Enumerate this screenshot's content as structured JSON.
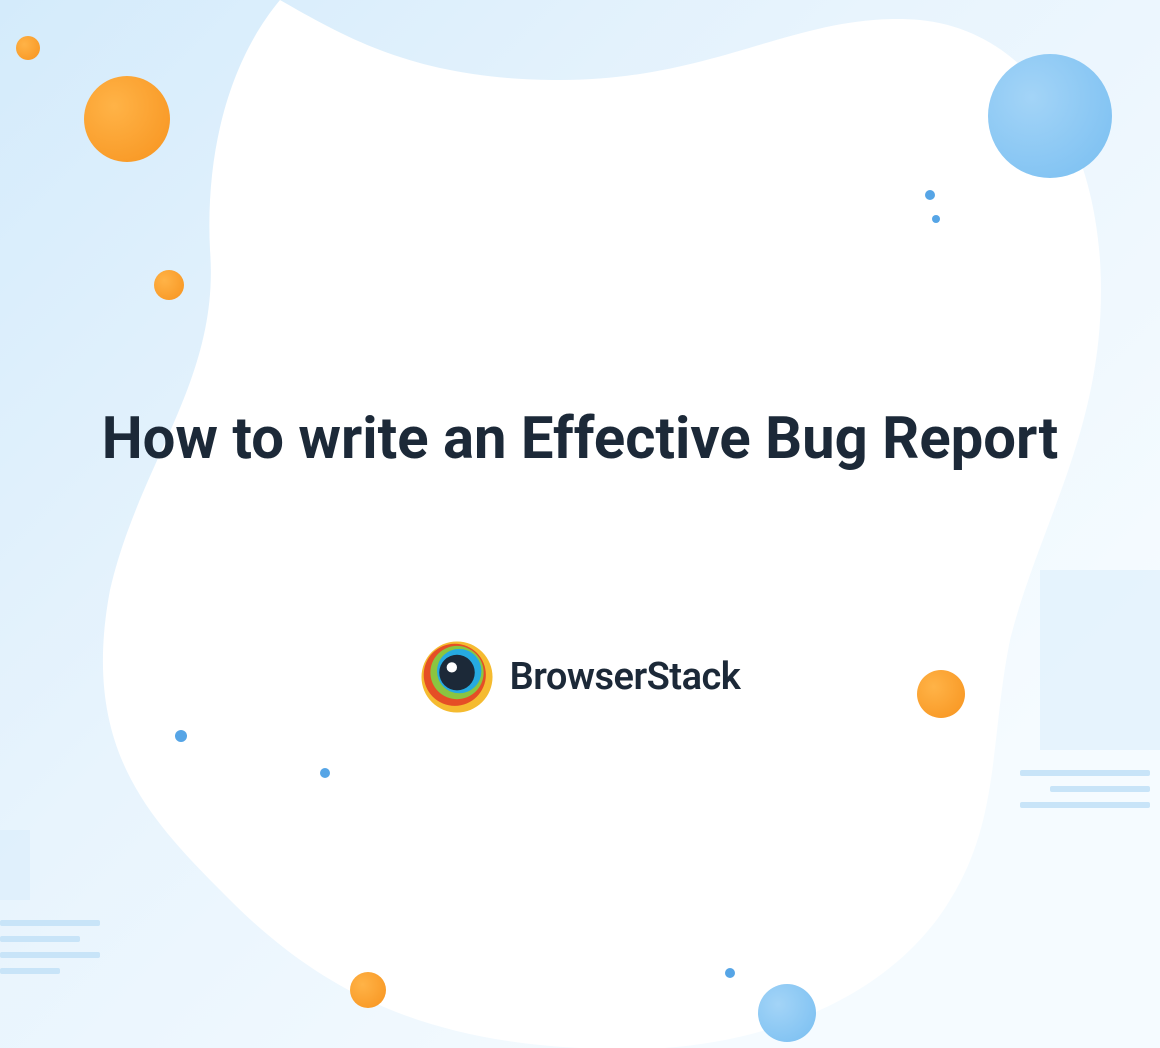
{
  "content": {
    "title": "How to write an Effective Bug Report",
    "brand": "BrowserStack"
  },
  "colors": {
    "orange": "#f7931e",
    "blue": "#78bef1",
    "text": "#1c2938",
    "bg_light": "#d4ebfb"
  }
}
